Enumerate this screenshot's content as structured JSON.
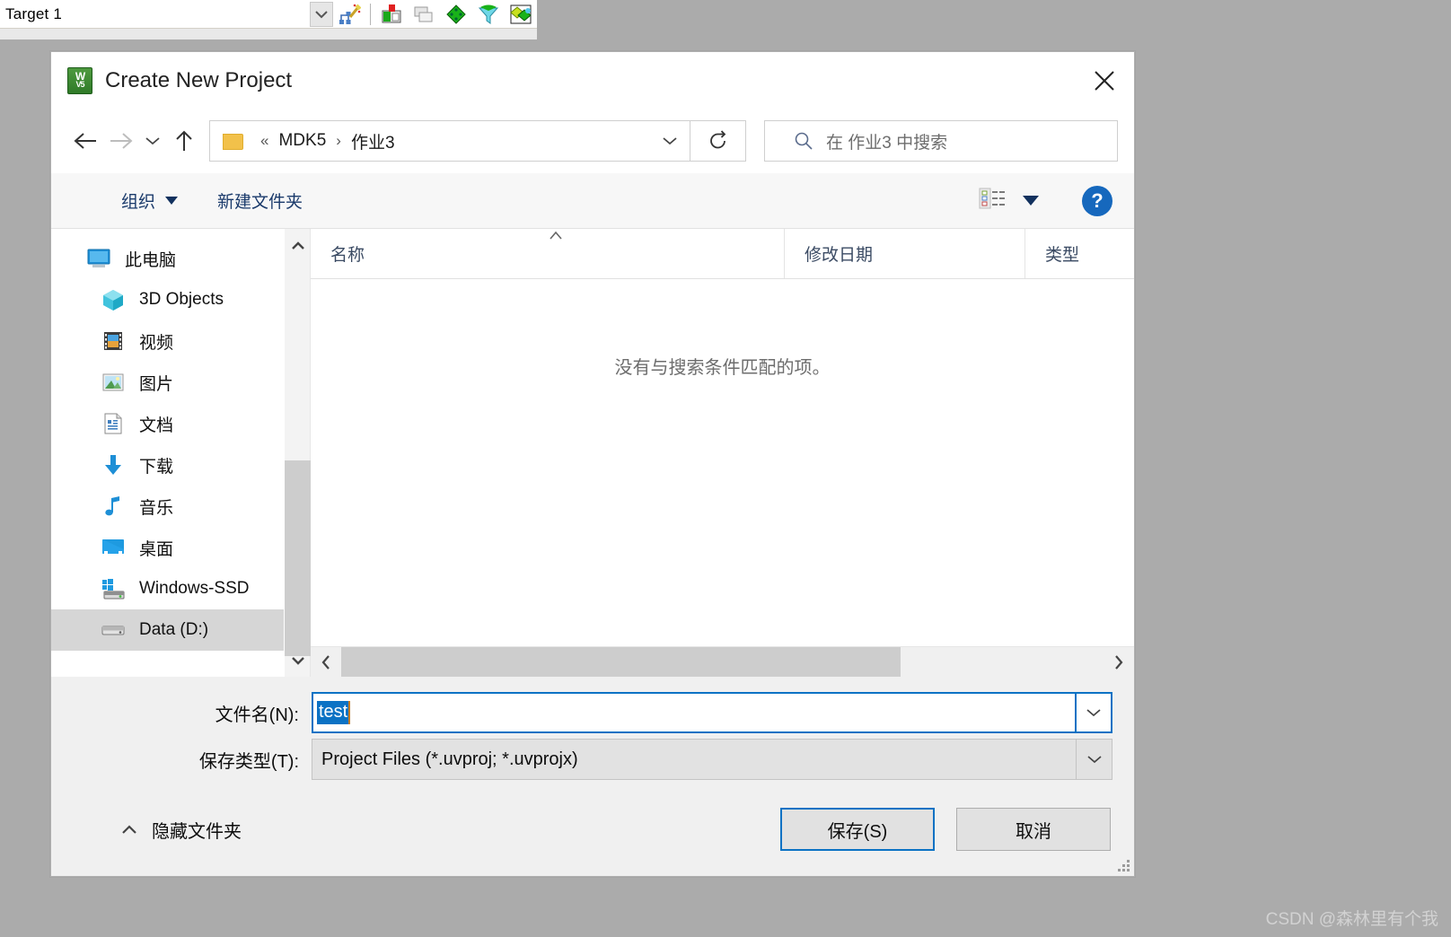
{
  "background_app": {
    "target_label": "Target 1",
    "toolbar_icons": [
      "target-dropdown-icon",
      "build-wizard-icon",
      "project-window-icon",
      "copy-windows-icon",
      "green-diamond-icon",
      "filter-diamond-icon",
      "manage-components-icon"
    ]
  },
  "dialog": {
    "title": "Create New Project",
    "app_icon_top": "W",
    "app_icon_bottom": "V5",
    "close_label": "✕"
  },
  "nav": {
    "back_icon": "arrow-left-icon",
    "forward_icon": "arrow-right-icon",
    "history_icon": "chevron-down-icon",
    "up_icon": "arrow-up-icon",
    "breadcrumb": {
      "prefix": "«",
      "items": [
        "MDK5",
        "作业3"
      ],
      "separator": "›"
    },
    "address_chevron": "chevron-down-icon",
    "refresh_icon": "refresh-icon"
  },
  "search": {
    "icon": "search-icon",
    "placeholder": "在 作业3 中搜索"
  },
  "command_bar": {
    "organize_label": "组织",
    "new_folder_label": "新建文件夹",
    "view_icon": "list-view-icon",
    "view_caret_icon": "chevron-down-icon",
    "help_label": "?"
  },
  "sidebar": {
    "items": [
      {
        "label": "此电脑",
        "icon": "this-pc-icon",
        "indent": false,
        "selected": false
      },
      {
        "label": "3D Objects",
        "icon": "3d-objects-icon",
        "indent": true,
        "selected": false
      },
      {
        "label": "视频",
        "icon": "videos-icon",
        "indent": true,
        "selected": false
      },
      {
        "label": "图片",
        "icon": "pictures-icon",
        "indent": true,
        "selected": false
      },
      {
        "label": "文档",
        "icon": "documents-icon",
        "indent": true,
        "selected": false
      },
      {
        "label": "下载",
        "icon": "downloads-icon",
        "indent": true,
        "selected": false
      },
      {
        "label": "音乐",
        "icon": "music-icon",
        "indent": true,
        "selected": false
      },
      {
        "label": "桌面",
        "icon": "desktop-icon",
        "indent": true,
        "selected": false
      },
      {
        "label": "Windows-SSD",
        "icon": "drive-windows-icon",
        "indent": true,
        "selected": false
      },
      {
        "label": "Data (D:)",
        "icon": "drive-icon",
        "indent": true,
        "selected": true
      }
    ]
  },
  "file_list": {
    "columns": [
      "名称",
      "修改日期",
      "类型"
    ],
    "sort_column": "名称",
    "sort_direction": "ascending",
    "rows": [],
    "empty_message": "没有与搜索条件匹配的项。"
  },
  "fields": {
    "filename_label": "文件名(N):",
    "filename_value": "test",
    "savetype_label": "保存类型(T):",
    "savetype_value": "Project Files (*.uvproj; *.uvprojx)"
  },
  "footer": {
    "hide_folders_label": "隐藏文件夹",
    "hide_folders_icon": "chevron-up-icon",
    "save_label": "保存(S)",
    "cancel_label": "取消"
  },
  "watermark": "CSDN @森林里有个我",
  "colors": {
    "accent": "#0b72c4",
    "help_blue": "#1668bd",
    "selection_blue": "#0b72c4",
    "sidebar_selected": "#d6d6d6",
    "page_background": "#ababab",
    "dialog_background": "#f0f0f0"
  }
}
